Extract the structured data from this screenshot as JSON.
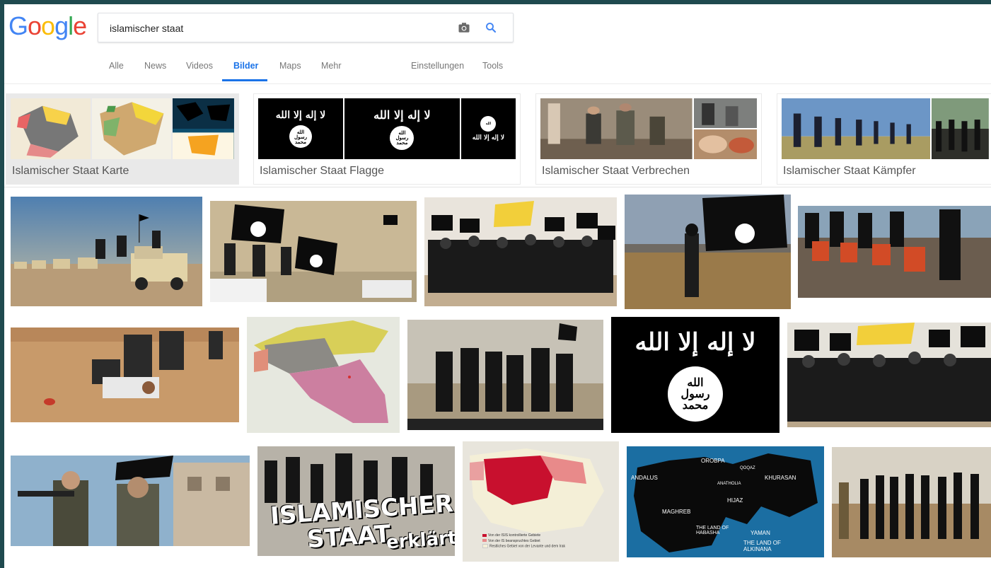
{
  "search": {
    "value": "islamischer staat"
  },
  "logo": {
    "text": "Google",
    "letters": [
      "G",
      "o",
      "o",
      "g",
      "l",
      "e"
    ],
    "colors": [
      "#4285f4",
      "#ea4335",
      "#fbbc05",
      "#4285f4",
      "#34a853",
      "#ea4335"
    ]
  },
  "tabs": [
    {
      "label": "Alle"
    },
    {
      "label": "News"
    },
    {
      "label": "Videos"
    },
    {
      "label": "Bilder",
      "active": true
    },
    {
      "label": "Maps"
    },
    {
      "label": "Mehr"
    },
    {
      "label": "Einstellungen"
    },
    {
      "label": "Tools"
    }
  ],
  "related": [
    {
      "label": "Islamischer Staat Karte"
    },
    {
      "label": "Islamischer Staat Flagge"
    },
    {
      "label": "Islamischer Staat Verbrechen"
    },
    {
      "label": "Islamischer Staat Kämpfer"
    }
  ],
  "flag": {
    "shahada": "لا إله إلا الله",
    "seal": [
      "الله",
      "رسول",
      "محمد"
    ]
  },
  "tiles": {
    "staat": {
      "line1": "ISLAMISCHER",
      "line2": "STAAT",
      "line3": "erklärt"
    },
    "map_labels": [
      "ANDALUS",
      "OROBPA",
      "KHURASAN",
      "MAGHREB",
      "HIJAZ",
      "YAMAN",
      "THE LAND OF HABASHA",
      "THE LAND OF ALKINANA",
      "ANATHOLIA",
      "QOQAZ"
    ],
    "legend": [
      "Von der ISIS kontrollierte Gebiete",
      "Von der IS beanspruchtes Gebiet",
      "Restliches Gebiet von der Levante und dem Irak"
    ]
  },
  "colors": {
    "accent": "#1a73e8",
    "frame": "#1f4a4f"
  }
}
